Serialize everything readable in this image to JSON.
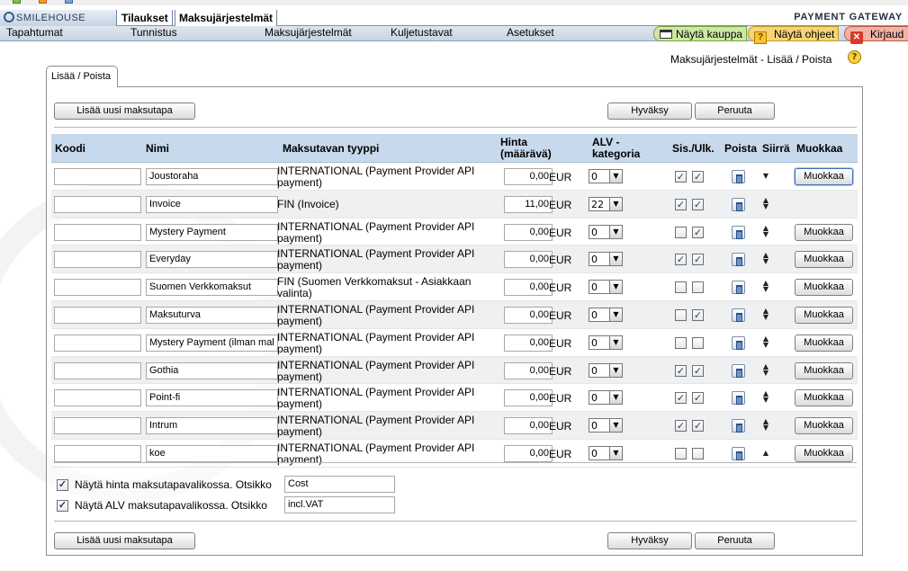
{
  "header": {
    "logo_text": "SMILEHOUSE",
    "tabs": [
      "Tilaukset",
      "Maksujärjestelmät"
    ],
    "gateway": "PAYMENT GATEWAY"
  },
  "nav": {
    "items": [
      "Tapahtumat",
      "Tunnistus",
      "Maksujärjestelmät",
      "Kuljetustavat",
      "Asetukset"
    ],
    "show_store": "Näytä kauppa",
    "show_help": "Näytä ohjeet",
    "logout": "Kirjaud"
  },
  "page": {
    "title": "Maksujärjestelmät - Lisää / Poista",
    "tab_label": "Lisää / Poista"
  },
  "buttons": {
    "add_new": "Lisää uusi maksutapa",
    "accept": "Hyväksy",
    "cancel": "Peruuta",
    "edit": "Muokkaa"
  },
  "columns": {
    "code": "Koodi",
    "name": "Nimi",
    "type": "Maksutavan tyyppi",
    "price": "Hinta\n(määrävä)",
    "vat": "ALV -\nkategoria",
    "incl": "Sis./Ulk.",
    "delete": "Poista",
    "move": "Siirrä",
    "edit": "Muokkaa"
  },
  "currency": "EUR",
  "rows": [
    {
      "code": "",
      "name": "Joustoraha",
      "type": "INTERNATIONAL (Payment Provider API payment)",
      "price": "0,00",
      "vat": "0",
      "sis": true,
      "ulk": true,
      "move": "down",
      "edit": true,
      "focus": true
    },
    {
      "code": "",
      "name": "Invoice",
      "type": "FIN (Invoice)",
      "price": "11,00",
      "vat": "22",
      "sis": true,
      "ulk": true,
      "move": "both",
      "edit": false,
      "focus": false
    },
    {
      "code": "",
      "name": "Mystery Payment",
      "type": "INTERNATIONAL (Payment Provider API payment)",
      "price": "0,00",
      "vat": "0",
      "sis": false,
      "ulk": true,
      "move": "both",
      "edit": true,
      "focus": false
    },
    {
      "code": "",
      "name": "Everyday",
      "type": "INTERNATIONAL (Payment Provider API payment)",
      "price": "0,00",
      "vat": "0",
      "sis": true,
      "ulk": true,
      "move": "both",
      "edit": true,
      "focus": false
    },
    {
      "code": "",
      "name": "Suomen Verkkomaksut",
      "type": "FIN (Suomen Verkkomaksut - Asiakkaan valinta)",
      "price": "0,00",
      "vat": "0",
      "sis": false,
      "ulk": false,
      "move": "both",
      "edit": true,
      "focus": false
    },
    {
      "code": "",
      "name": "Maksuturva",
      "type": "INTERNATIONAL (Payment Provider API payment)",
      "price": "0,00",
      "vat": "0",
      "sis": false,
      "ulk": true,
      "move": "both",
      "edit": true,
      "focus": false
    },
    {
      "code": "",
      "name": "Mystery Payment (ilman mal",
      "type": "INTERNATIONAL (Payment Provider API payment)",
      "price": "0,00",
      "vat": "0",
      "sis": false,
      "ulk": false,
      "move": "both",
      "edit": true,
      "focus": false
    },
    {
      "code": "",
      "name": "Gothia",
      "type": "INTERNATIONAL (Payment Provider API payment)",
      "price": "0,00",
      "vat": "0",
      "sis": true,
      "ulk": true,
      "move": "both",
      "edit": true,
      "focus": false
    },
    {
      "code": "",
      "name": "Point-fi",
      "type": "INTERNATIONAL (Payment Provider API payment)",
      "price": "0,00",
      "vat": "0",
      "sis": true,
      "ulk": true,
      "move": "both",
      "edit": true,
      "focus": false
    },
    {
      "code": "",
      "name": "Intrum",
      "type": "INTERNATIONAL (Payment Provider API payment)",
      "price": "0,00",
      "vat": "0",
      "sis": true,
      "ulk": true,
      "move": "both",
      "edit": true,
      "focus": false
    },
    {
      "code": "",
      "name": "koe",
      "type": "INTERNATIONAL (Payment Provider API payment)",
      "price": "0,00",
      "vat": "0",
      "sis": false,
      "ulk": false,
      "move": "up",
      "edit": true,
      "focus": false
    }
  ],
  "options": {
    "show_price_label": "Näytä hinta maksutapavalikossa. Otsikko",
    "show_price_checked": true,
    "price_title_value": "Cost",
    "show_vat_label": "Näytä ALV maksutapavalikossa. Otsikko",
    "show_vat_checked": true,
    "vat_title_value": "incl.VAT"
  },
  "colors": {
    "table_header": "#c7d9ec",
    "nav_green": "#cfe7a6",
    "nav_yellow": "#f7d474",
    "nav_red": "#f2b3a6"
  }
}
